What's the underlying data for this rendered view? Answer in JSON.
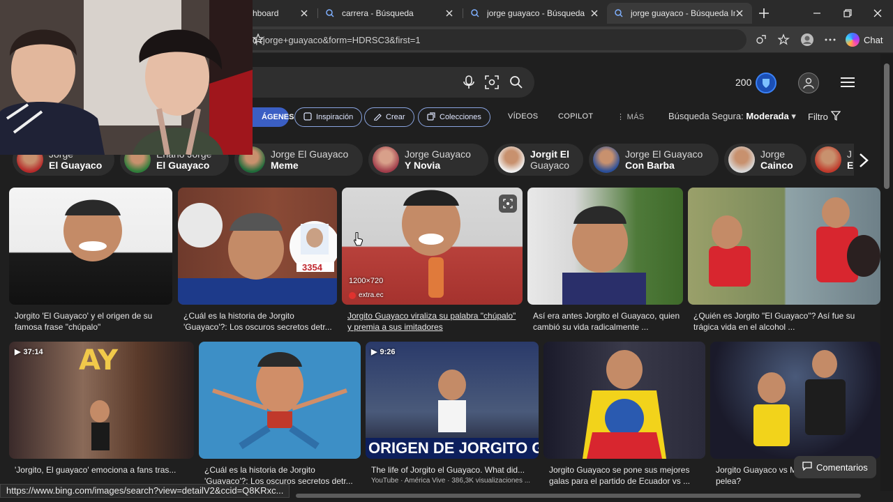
{
  "browser": {
    "tabs": [
      {
        "title": "hboard"
      },
      {
        "title": "carrera - Búsqueda"
      },
      {
        "title": "jorge guayaco - Búsqueda"
      },
      {
        "title": "jorge guayaco - Búsqueda Imá"
      }
    ],
    "address": "q=jorge+guayaco&form=HDRSC3&first=1",
    "chat_label": "Chat"
  },
  "bing": {
    "points": "200",
    "tabs": {
      "images": "ÁGENES",
      "inspiracion": "Inspiración",
      "crear": "Crear",
      "colecciones": "Colecciones",
      "videos": "VÍDEOS",
      "copilot": "COPILOT",
      "mas": "MÁS"
    },
    "safesearch_label": "Búsqueda Segura:",
    "safesearch_value": "Moderada",
    "filter_label": "Filtro"
  },
  "chips": [
    {
      "line1": "Jorge",
      "line2": "El Guayaco"
    },
    {
      "line1": "Enano Jorge",
      "line2": "El Guayaco"
    },
    {
      "line1": "Jorge El Guayaco",
      "line2": "Meme"
    },
    {
      "line1": "Jorge Guayaco",
      "line2": "Y Novia"
    },
    {
      "line1": "Jorgit El",
      "line2": "Guayaco"
    },
    {
      "line1": "Jorge El Guayaco",
      "line2": "Con Barba"
    },
    {
      "line1": "Jorge",
      "line2": "Cainco"
    },
    {
      "line1": "J",
      "line2": "E"
    }
  ],
  "results_row1": [
    {
      "caption": "Jorgito 'El Guayaco' y el origen de su famosa frase \"chúpalo\""
    },
    {
      "caption": "¿Cuál es la historia de Jorgito 'Guayaco'?: Los oscuros secretos detr...",
      "overlay": "3354"
    },
    {
      "caption": "Jorgito Guayaco viraliza su palabra \"chúpalo\" y premia a sus imitadores",
      "dimensions": "1200×720",
      "source": "extra.ec"
    },
    {
      "caption": "Así era antes Jorgito el Guayaco, quien cambió su vida radicalmente ..."
    },
    {
      "caption": "¿Quién es Jorgito \"El Guayaco\"? Así fue su trágica vida en el alcohol ..."
    }
  ],
  "results_row2": [
    {
      "caption": "'Jorgito, El guayaco' emociona a fans tras...",
      "duration": "37:14"
    },
    {
      "caption": "¿Cuál es la historia de Jorgito 'Guayaco'?: Los oscuros secretos detr..."
    },
    {
      "caption": "The life of Jorgito el Guayaco. What did...",
      "duration": "9:26",
      "banner": "ORIGEN DE JORGITO GUAY",
      "sub": "YouTube · América Vive · 386,3K visualizaciones ..."
    },
    {
      "caption": "Jorgito Guayaco se pone sus mejores galas para el partido de Ecuador vs ..."
    },
    {
      "caption": "Jorgito Guayaco vs M... ver EN VIVO la pelea?"
    }
  ],
  "status_url": "https://www.bing.com/images/search?view=detailV2&ccid=Q8KRxc...",
  "feedback_label": "Comentarios",
  "colors": {
    "accent": "#3b5fc4",
    "bg": "#1f1f1f"
  }
}
